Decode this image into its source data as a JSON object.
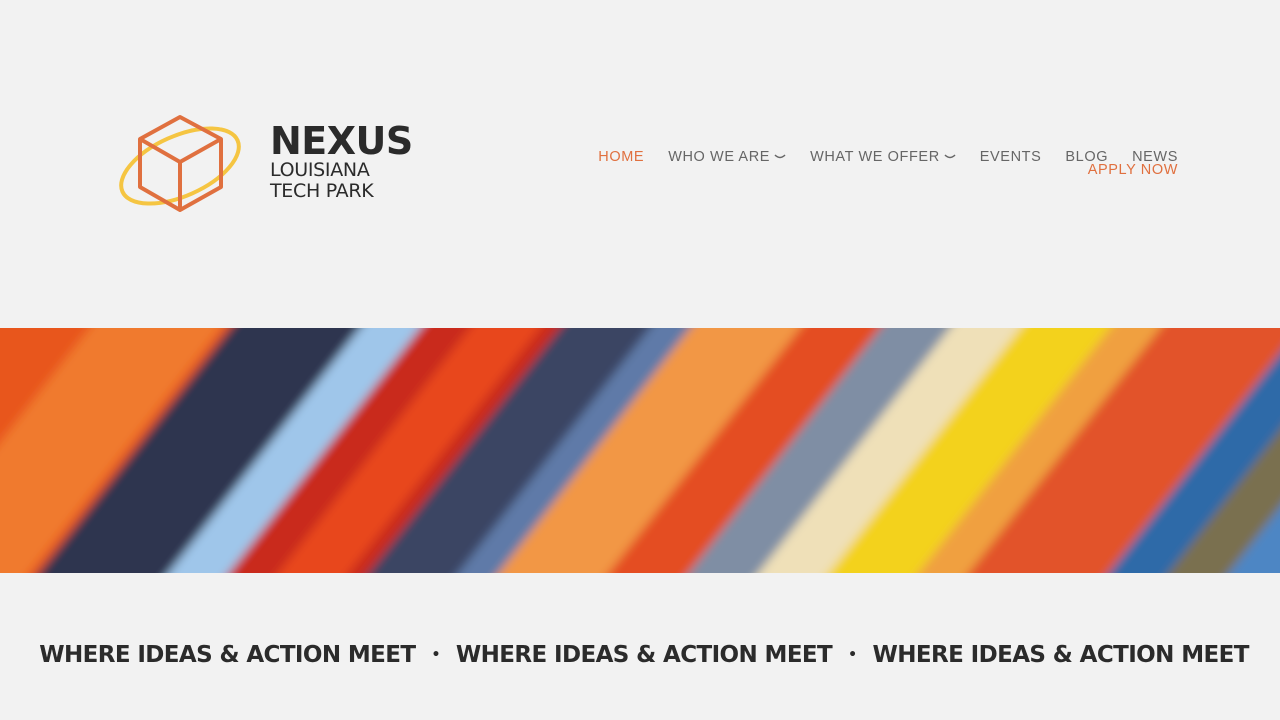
{
  "logo": {
    "title": "NEXUS",
    "line1": "LOUISIANA",
    "line2": "TECH PARK",
    "colors": {
      "cube": "#e0703f",
      "ring": "#f5c542",
      "text": "#2b2b2b"
    }
  },
  "nav": {
    "items": [
      {
        "label": "HOME",
        "active": true,
        "dropdown": false
      },
      {
        "label": "WHO WE ARE",
        "active": false,
        "dropdown": true
      },
      {
        "label": "WHAT WE OFFER",
        "active": false,
        "dropdown": true
      },
      {
        "label": "EVENTS",
        "active": false,
        "dropdown": false
      },
      {
        "label": "BLOG",
        "active": false,
        "dropdown": false
      },
      {
        "label": "NEWS",
        "active": false,
        "dropdown": false
      }
    ],
    "apply_label": "APPLY NOW",
    "accent_color": "#e0703f"
  },
  "hero": {
    "image": "colorful-cables"
  },
  "tagline": {
    "phrases": [
      "WHERE IDEAS & ACTION MEET",
      "WHERE IDEAS & ACTION MEET",
      "WHERE IDEAS & ACTION MEET"
    ],
    "separator": "•"
  }
}
